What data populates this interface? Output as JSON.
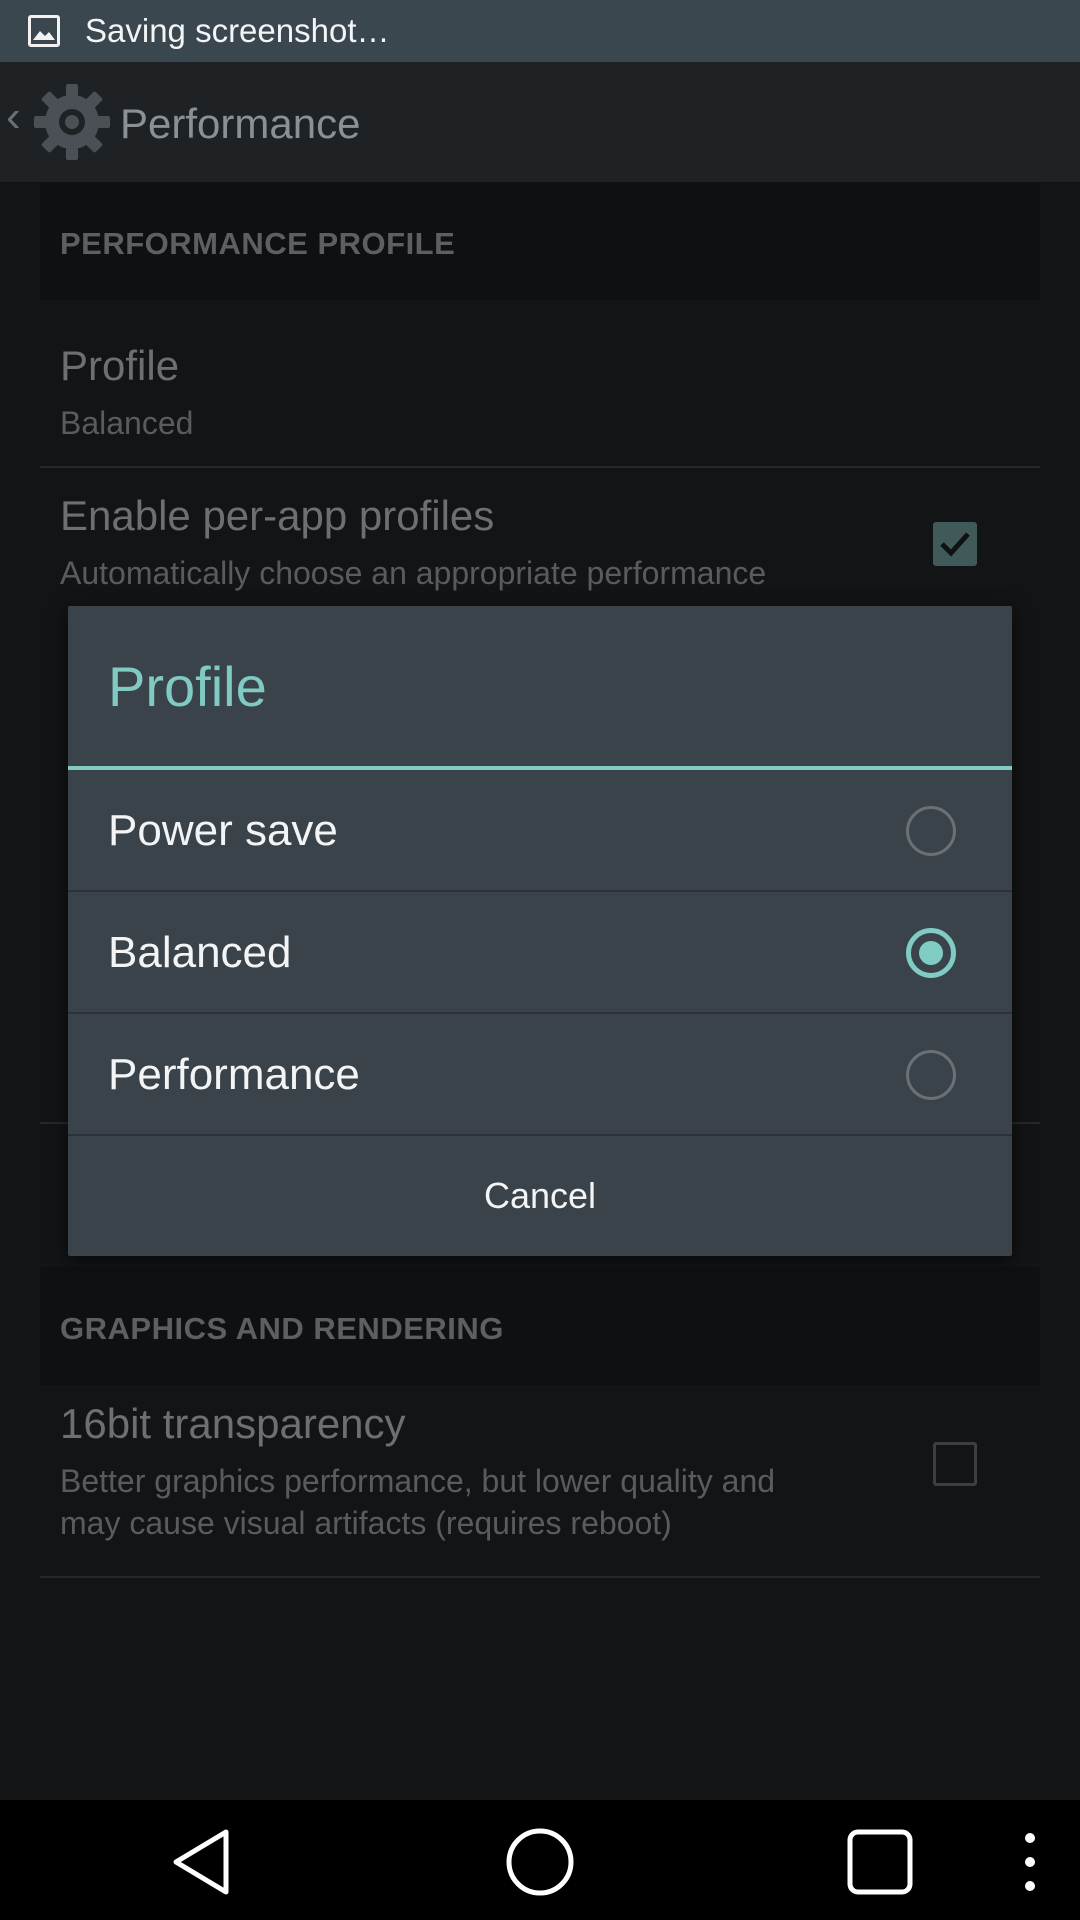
{
  "status_bar": {
    "text": "Saving screenshot…"
  },
  "action_bar": {
    "title": "Performance"
  },
  "sections": {
    "performance_profile": "PERFORMANCE PROFILE",
    "graphics": "GRAPHICS AND RENDERING"
  },
  "prefs": {
    "profile": {
      "title": "Profile",
      "summary": "Balanced"
    },
    "per_app": {
      "title": "Enable per-app profiles",
      "summary": "Automatically choose an appropriate performance",
      "checked": true
    },
    "transparency": {
      "title": "16bit transparency",
      "summary_line1": "Better graphics performance, but lower quality and",
      "summary_line2": "may cause visual artifacts (requires reboot)",
      "checked": false
    }
  },
  "dialog": {
    "title": "Profile",
    "options": [
      {
        "label": "Power save",
        "selected": false
      },
      {
        "label": "Balanced",
        "selected": true
      },
      {
        "label": "Performance",
        "selected": false
      }
    ],
    "cancel": "Cancel"
  },
  "colors": {
    "accent": "#80cbc4",
    "dialog_bg": "#3a4349",
    "status_bar": "#3a474e"
  }
}
